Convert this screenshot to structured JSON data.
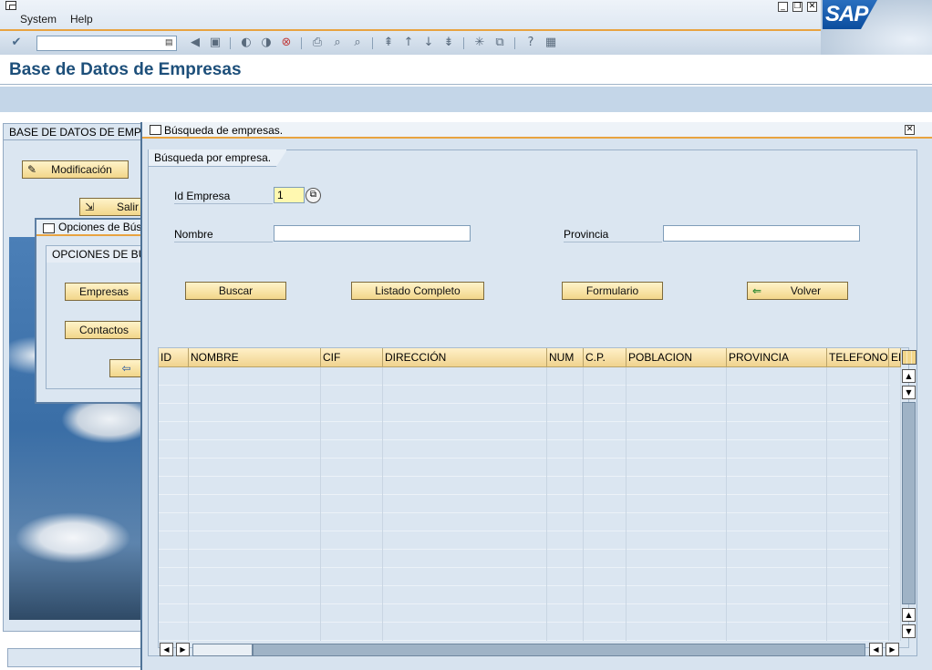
{
  "menubar": {
    "items": [
      {
        "label": "System",
        "accel": "S"
      },
      {
        "label": "Help",
        "accel": "H"
      }
    ]
  },
  "toolbar": {
    "command_value": ""
  },
  "title": "Base de Datos de Empresas",
  "background": {
    "frame_title": "BASE DE DATOS DE EMPRESAS",
    "modify_button": "Modificación",
    "save_button": "Salir",
    "sub_dialog_title": "Opciones de Búsqueda",
    "group_title": "OPCIONES DE BÚSQUEDA",
    "companies_button": "Empresas",
    "contacts_button": "Contactos"
  },
  "dialog": {
    "title": "Búsqueda de empresas.",
    "tab_label": "Búsqueda por empresa.",
    "id_label": "Id Empresa",
    "id_value": "1",
    "name_label": "Nombre",
    "name_value": "",
    "province_label": "Provincia",
    "province_value": "",
    "buttons": {
      "search": "Buscar",
      "full_list": "Listado Completo",
      "form": "Formulario",
      "back": "Volver"
    }
  },
  "grid": {
    "columns": [
      "ID",
      "NOMBRE",
      "CIF",
      "DIRECCIÓN",
      "NUM",
      "C.P.",
      "POBLACION",
      "PROVINCIA",
      "TELEFONO",
      "EMAIL"
    ],
    "rows": []
  },
  "colors": {
    "accent": "#e8a340",
    "title": "#1d4f7a",
    "button_face": "#f2d68a",
    "dialog_bg": "#d7e3ef"
  }
}
